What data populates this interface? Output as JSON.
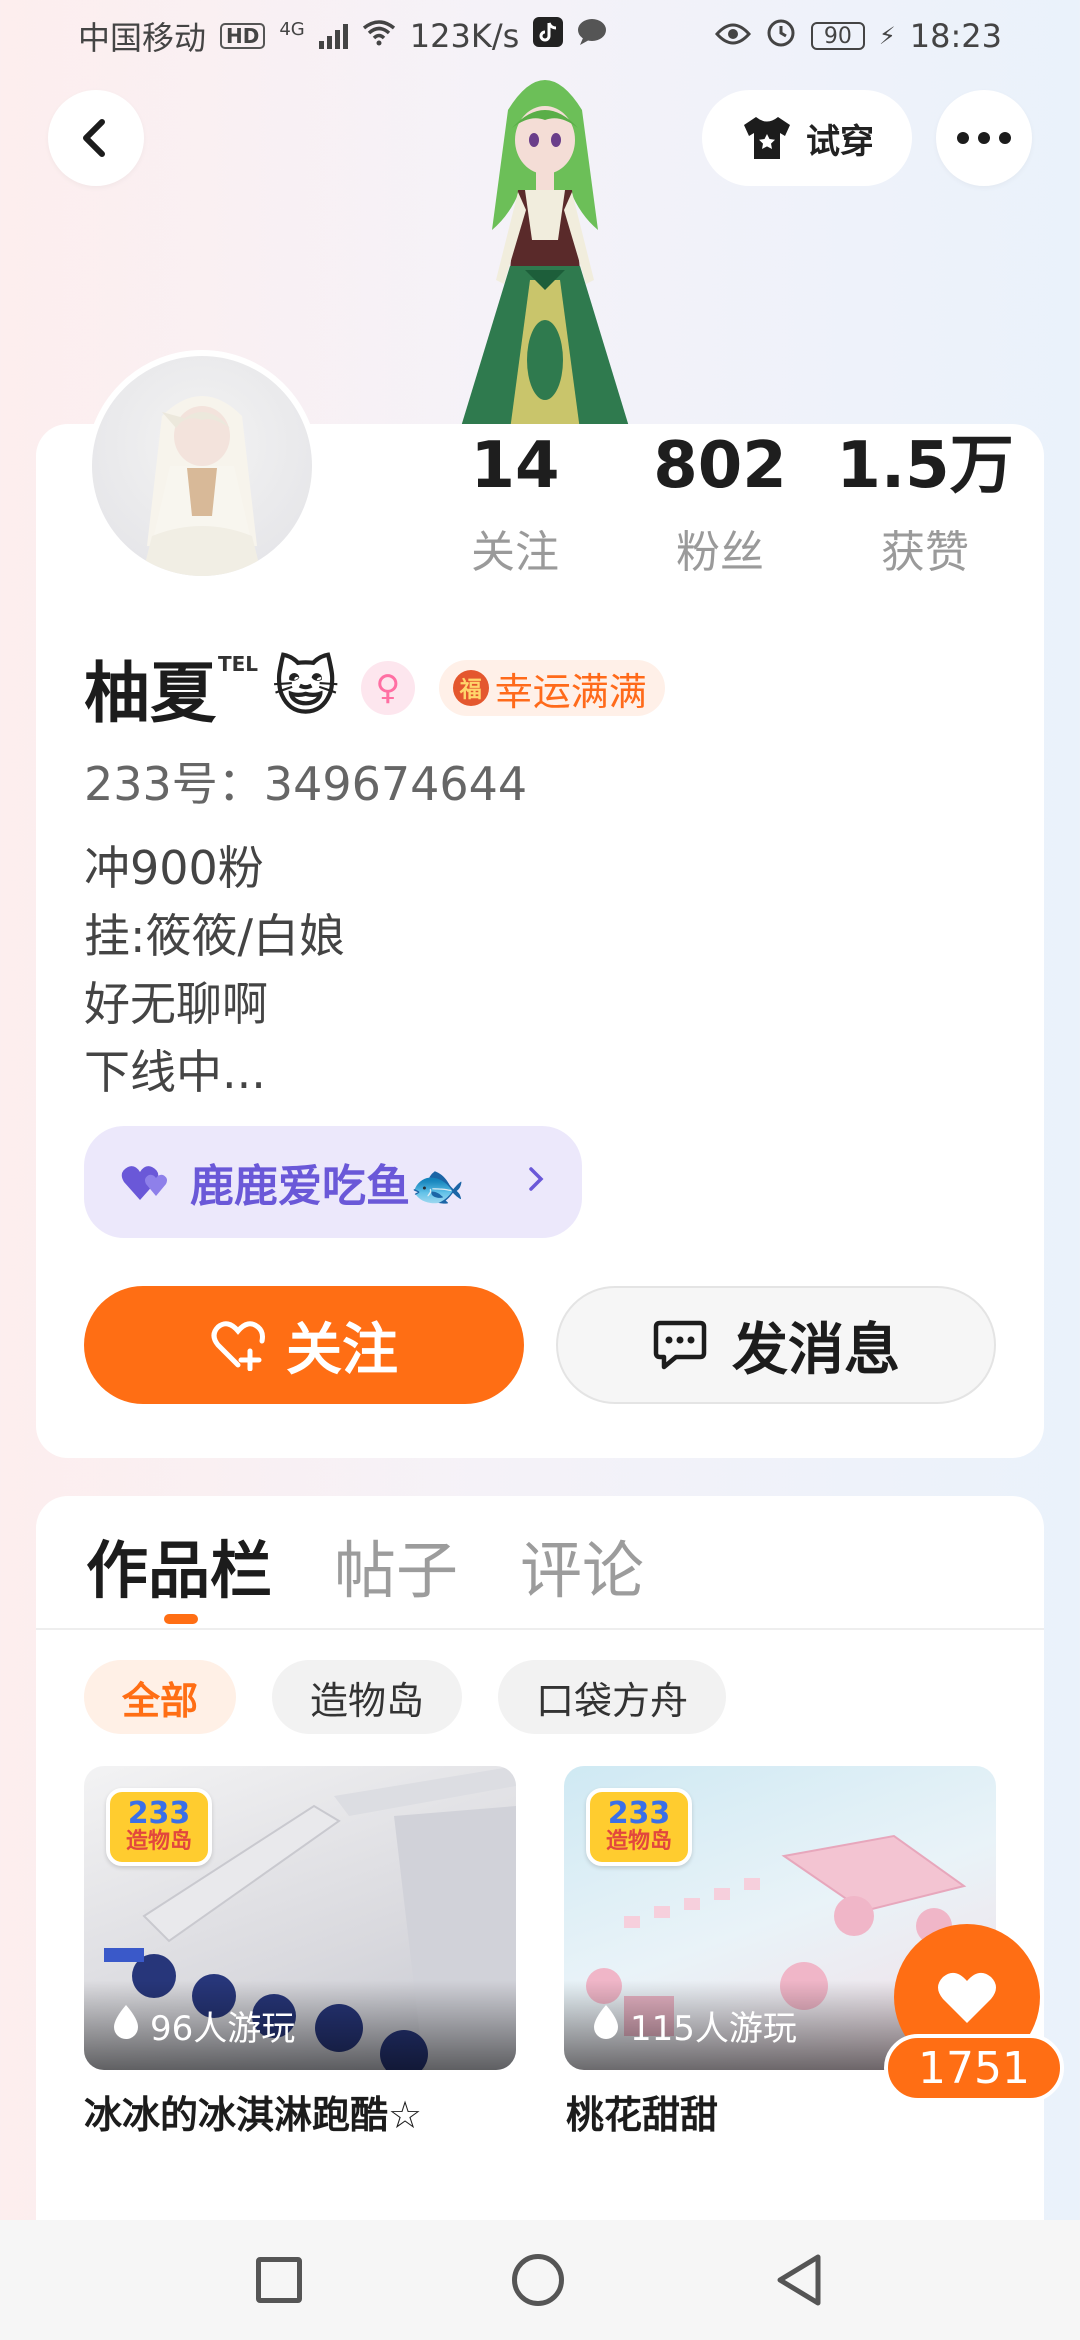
{
  "status_bar": {
    "carrier": "中国移动",
    "hd_badge": "HD",
    "network": "4G",
    "speed": "123K/s",
    "battery": "90",
    "time": "18:23"
  },
  "header": {
    "try_on_label": "试穿"
  },
  "stats": [
    {
      "value": "14",
      "label": "关注"
    },
    {
      "value": "802",
      "label": "粉丝"
    },
    {
      "value": "1.5万",
      "label": "获赞"
    }
  ],
  "profile": {
    "name": "柚夏",
    "name_tag": "TEL",
    "name_emoji": "😺",
    "gender_symbol": "♀",
    "luck_badge": "幸运满满",
    "uid": "233号：349674644",
    "bio": [
      "冲900粉",
      "挂:筱筱/白娘",
      "好无聊啊",
      "下线中..."
    ],
    "fan_tag": "鹿鹿爱吃鱼🐟"
  },
  "actions": {
    "follow_label": "关注",
    "message_label": "发消息"
  },
  "tabs": [
    {
      "label": "作品栏",
      "active": true
    },
    {
      "label": "帖子",
      "active": false
    },
    {
      "label": "评论",
      "active": false
    }
  ],
  "chips": [
    {
      "label": "全部",
      "active": true
    },
    {
      "label": "造物岛",
      "active": false
    },
    {
      "label": "口袋方舟",
      "active": false
    }
  ],
  "games": [
    {
      "logo_top": "233",
      "logo_bottom": "造物岛",
      "players": "96人游玩",
      "title": "冰冰的冰淇淋跑酷☆"
    },
    {
      "logo_top": "233",
      "logo_bottom": "造物岛",
      "players": "115人游玩",
      "title": "桃花甜甜"
    }
  ],
  "floating_like": {
    "count": "1751"
  },
  "colors": {
    "accent": "#ff6e14",
    "fan_tag_text": "#6a58d8",
    "fan_tag_bg": "#ece8fb"
  },
  "icons": {
    "back": "chevron-left-icon",
    "tshirt": "tshirt-icon",
    "more": "more-dots-icon",
    "follow": "heart-plus-icon",
    "message": "chat-bubble-icon",
    "fan_heart": "double-heart-icon",
    "players": "flame-icon",
    "like": "heart-icon"
  }
}
